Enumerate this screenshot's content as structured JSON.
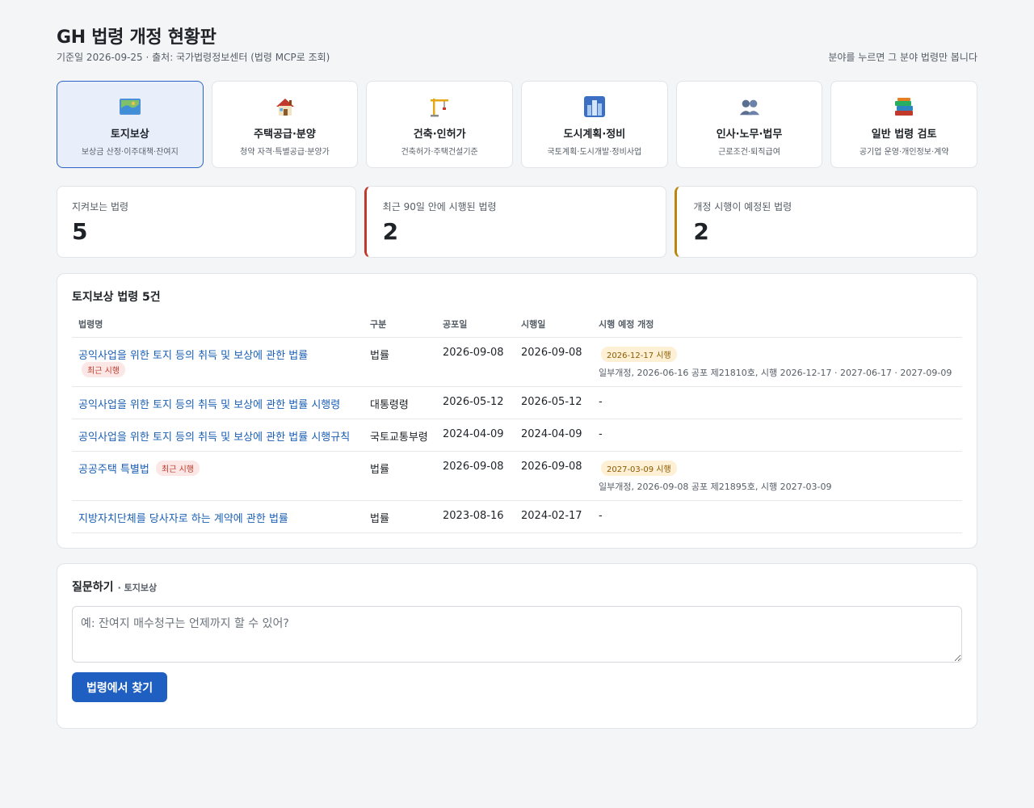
{
  "header": {
    "title": "GH 법령 개정 현황판",
    "subtitle": "기준일 2026-09-25 · 출처: 국가법령정보센터 (법령 MCP로 조회)",
    "hint": "분야를 누르면 그 분야 법령만 봅니다"
  },
  "categories": [
    {
      "icon": "map-icon",
      "name": "토지보상",
      "desc": "보상금 산정·이주대책·잔여지",
      "active": true
    },
    {
      "icon": "house-icon",
      "name": "주택공급·분양",
      "desc": "청약 자격·특별공급·분양가",
      "active": false
    },
    {
      "icon": "crane-icon",
      "name": "건축·인허가",
      "desc": "건축허가·주택건설기준",
      "active": false
    },
    {
      "icon": "city-icon",
      "name": "도시계획·정비",
      "desc": "국토계획·도시개발·정비사업",
      "active": false
    },
    {
      "icon": "people-icon",
      "name": "인사·노무·법무",
      "desc": "근로조건·퇴직급여",
      "active": false
    },
    {
      "icon": "books-icon",
      "name": "일반 법령 검토",
      "desc": "공기업 운영·개인정보·계약",
      "active": false
    }
  ],
  "stats": [
    {
      "label": "지켜보는 법령",
      "value": "5"
    },
    {
      "label": "최근 90일 안에 시행된 법령",
      "value": "2"
    },
    {
      "label": "개정 시행이 예정된 법령",
      "value": "2"
    }
  ],
  "laws_panel": {
    "title": "토지보상 법령 5건",
    "columns": [
      "법령명",
      "구분",
      "공포일",
      "시행일",
      "시행 예정 개정"
    ],
    "rows": [
      {
        "name": "공익사업을 위한 토지 등의 취득 및 보상에 관한 법률",
        "recent_badge": "최근 시행",
        "type": "법률",
        "promulgated": "2026-09-08",
        "effective": "2026-09-08",
        "upcoming_badge": "2026-12-17 시행",
        "upcoming_detail": "일부개정, 2026-06-16 공포 제21810호, 시행 2026-12-17 · 2027-06-17 · 2027-09-09"
      },
      {
        "name": "공익사업을 위한 토지 등의 취득 및 보상에 관한 법률 시행령",
        "recent_badge": "",
        "type": "대통령령",
        "promulgated": "2026-05-12",
        "effective": "2026-05-12",
        "upcoming_badge": "",
        "upcoming_detail": "-"
      },
      {
        "name": "공익사업을 위한 토지 등의 취득 및 보상에 관한 법률 시행규칙",
        "recent_badge": "",
        "type": "국토교통부령",
        "promulgated": "2024-04-09",
        "effective": "2024-04-09",
        "upcoming_badge": "",
        "upcoming_detail": "-"
      },
      {
        "name": "공공주택 특별법",
        "recent_badge": "최근 시행",
        "type": "법률",
        "promulgated": "2026-09-08",
        "effective": "2026-09-08",
        "upcoming_badge": "2027-03-09 시행",
        "upcoming_detail": "일부개정, 2026-09-08 공포 제21895호, 시행 2027-03-09"
      },
      {
        "name": "지방자치단체를 당사자로 하는 계약에 관한 법률",
        "recent_badge": "",
        "type": "법률",
        "promulgated": "2023-08-16",
        "effective": "2024-02-17",
        "upcoming_badge": "",
        "upcoming_detail": "-"
      }
    ]
  },
  "ask": {
    "title": "질문하기",
    "scope": "· 토지보상",
    "placeholder": "예: 잔여지 매수청구는 언제까지 할 수 있어?",
    "button": "법령에서 찾기"
  }
}
